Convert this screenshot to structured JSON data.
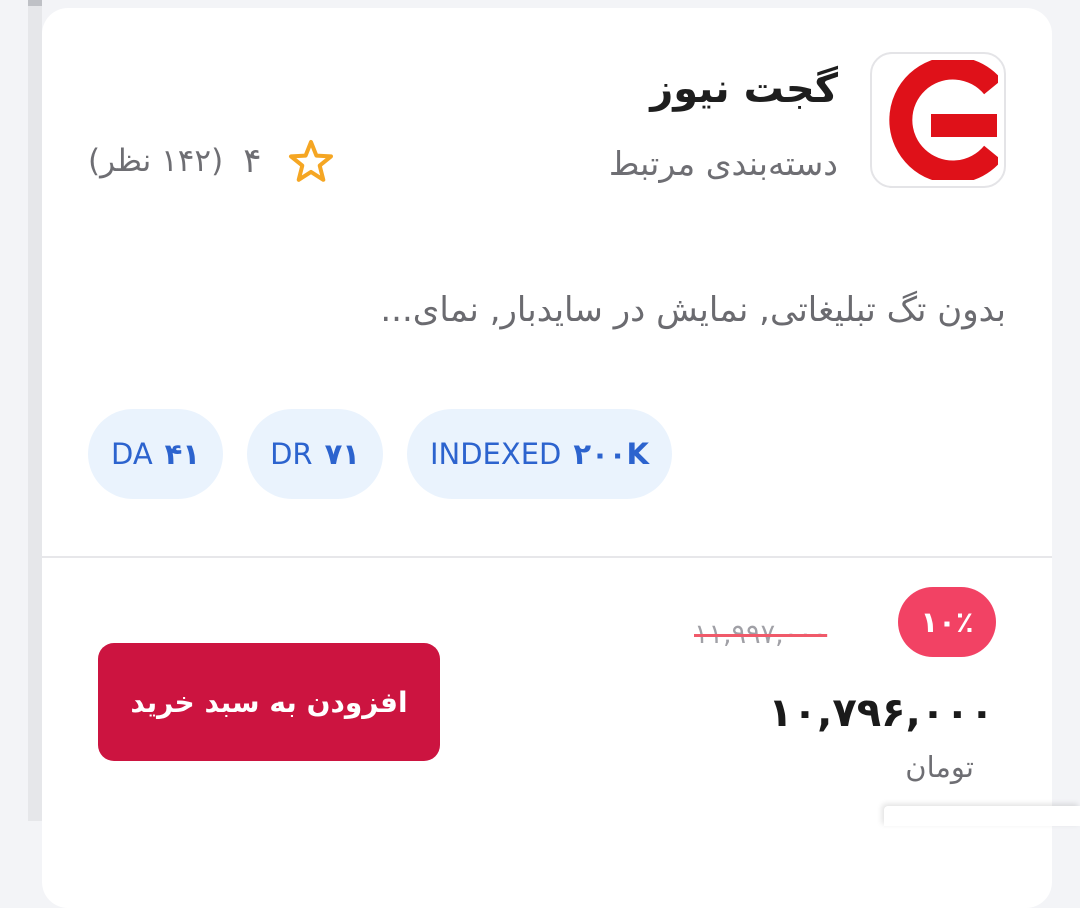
{
  "product": {
    "name": "گجت نیوز",
    "category": "دسته‌بندی مرتبط",
    "logo_icon": "gadgetnews-logo",
    "rating": {
      "value": "۴",
      "review_count": "(۱۴۲ نظر)",
      "icon": "star-outline-icon",
      "star_color": "#f5a623"
    },
    "description": "بدون تگ تبلیغاتی, نمایش در سایدبار, نمای...",
    "tags": [
      {
        "label": "DA",
        "value": "۴۱"
      },
      {
        "label": "DR",
        "value": "۷۱"
      },
      {
        "label": "INDEXED",
        "value": "۲۰۰K"
      }
    ]
  },
  "pricing": {
    "discount_badge": "۱۰٪",
    "old_price": "۱۱,۹۹۷,۰۰۰",
    "price": "۱۰,۷۹۶,۰۰۰",
    "currency": "تومان"
  },
  "actions": {
    "add_to_cart_label": "افزودن به سبد خرید"
  },
  "colors": {
    "accent": "#cc1440",
    "discount": "#f24264",
    "tag_bg": "#eaf3fd",
    "tag_text": "#2c63ce",
    "logo_red": "#df1119"
  }
}
